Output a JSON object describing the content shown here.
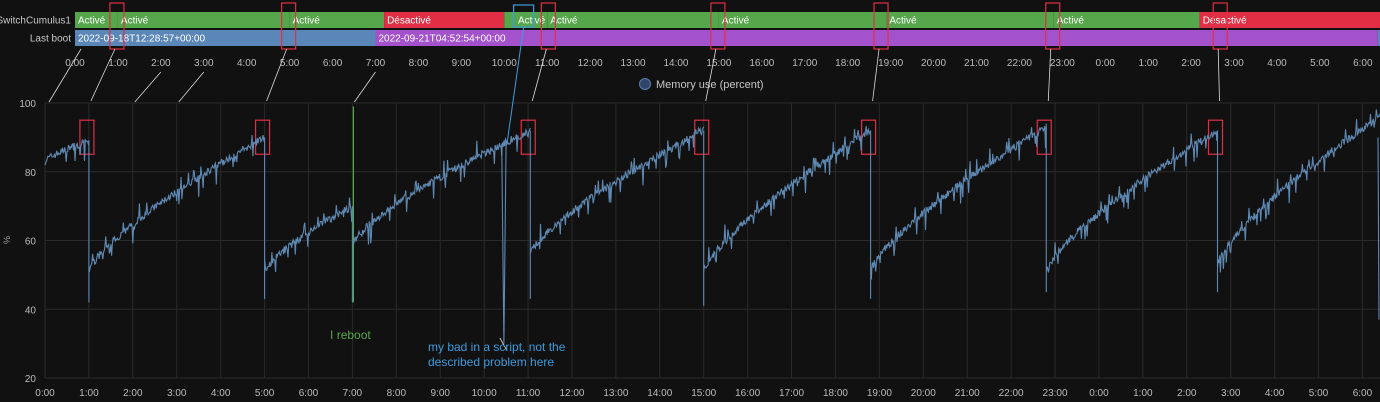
{
  "colors": {
    "background": "#111111",
    "active": "#56a64b",
    "inactive": "#e02f44",
    "boot_blue": "#5b87b8",
    "boot_purple": "#a352cc",
    "series": "#5f89b3",
    "grid": "#2a2a2a",
    "highlight": "#e02f44",
    "reboot_note": "#56a64b",
    "script_note": "#3e9bdc"
  },
  "timeline": {
    "rows": [
      {
        "label": "SwitchCumulus1",
        "segments": [
          {
            "label": "Activé",
            "state": "active",
            "start": 0.0,
            "end": 1.0
          },
          {
            "label": "Activé",
            "state": "active",
            "start": 1.0,
            "end": 5.0
          },
          {
            "label": "Activé",
            "state": "active",
            "start": 5.0,
            "end": 7.2
          },
          {
            "label": "Désactivé",
            "state": "inactive",
            "start": 7.2,
            "end": 10.0
          },
          {
            "label": "",
            "state": "active",
            "start": 10.0,
            "end": 10.25
          },
          {
            "label": "Activé",
            "state": "active",
            "start": 10.25,
            "end": 11.0
          },
          {
            "label": "Activé",
            "state": "active",
            "start": 11.0,
            "end": 15.0
          },
          {
            "label": "Activé",
            "state": "active",
            "start": 15.0,
            "end": 18.9
          },
          {
            "label": "Activé",
            "state": "active",
            "start": 18.9,
            "end": 22.8
          },
          {
            "label": "Activé",
            "state": "active",
            "start": 22.8,
            "end": 26.2
          },
          {
            "label": "Désactivé",
            "state": "inactive",
            "start": 26.2,
            "end": 30.4
          }
        ]
      },
      {
        "label": "Last boot",
        "segments": [
          {
            "label": "2022-09-18T12:28:57+00:00",
            "state": "boot_blue",
            "start": 0.0,
            "end": 7.0
          },
          {
            "label": "2022-09-21T04:52:54+00:00",
            "state": "boot_purple",
            "start": 7.0,
            "end": 30.35
          },
          {
            "label": "",
            "state": "boot_blue",
            "start": 30.35,
            "end": 30.4
          }
        ]
      }
    ],
    "tick_labels": [
      "0:00",
      "1:00",
      "2:00",
      "3:00",
      "4:00",
      "5:00",
      "6:00",
      "7:00",
      "8:00",
      "9:00",
      "10:00",
      "11:00",
      "12:00",
      "13:00",
      "14:00",
      "15:00",
      "16:00",
      "17:00",
      "18:00",
      "19:00",
      "20:00",
      "21:00",
      "22:00",
      "23:00",
      "0:00",
      "1:00",
      "2:00",
      "3:00",
      "4:00",
      "5:00",
      "6:00"
    ]
  },
  "chart_data": {
    "type": "line",
    "legend": [
      "Memory use (percent)"
    ],
    "legend_position": "top-center",
    "ylabel": "%",
    "ylim": [
      20,
      100
    ],
    "yticks": [
      20,
      40,
      60,
      80,
      100
    ],
    "xlim": [
      0,
      30.4
    ],
    "x_unit": "hours from 0:00 (wrapping past midnight)",
    "xtick_labels": [
      "0:00",
      "1:00",
      "2:00",
      "3:00",
      "4:00",
      "5:00",
      "6:00",
      "7:00",
      "8:00",
      "9:00",
      "10:00",
      "11:00",
      "12:00",
      "13:00",
      "14:00",
      "15:00",
      "16:00",
      "17:00",
      "18:00",
      "19:00",
      "20:00",
      "21:00",
      "22:00",
      "23:00",
      "0:00",
      "1:00",
      "2:00",
      "3:00",
      "4:00",
      "5:00",
      "6:00"
    ],
    "grid": true,
    "series": [
      {
        "name": "Memory use (percent)",
        "cycles": [
          {
            "start": 0.0,
            "end": 1.0,
            "y0": 83,
            "y1": 89
          },
          {
            "start": 1.0,
            "end": 5.0,
            "y0": 51,
            "y1": 90
          },
          {
            "start": 5.0,
            "end": 7.0,
            "y0": 51,
            "y1": 70
          },
          {
            "start": 7.0,
            "end": 11.05,
            "y0": 59,
            "y1": 92
          },
          {
            "start": 11.05,
            "end": 15.0,
            "y0": 56,
            "y1": 92
          },
          {
            "start": 15.0,
            "end": 18.8,
            "y0": 51,
            "y1": 92
          },
          {
            "start": 18.8,
            "end": 22.8,
            "y0": 51,
            "y1": 93
          },
          {
            "start": 22.8,
            "end": 26.7,
            "y0": 51,
            "y1": 92
          },
          {
            "start": 26.7,
            "end": 30.4,
            "y0": 53,
            "y1": 96
          }
        ],
        "dips": [
          {
            "x": 1.0,
            "y": 42
          },
          {
            "x": 5.0,
            "y": 43
          },
          {
            "x": 7.0,
            "y": 42
          },
          {
            "x": 10.45,
            "y": 30
          },
          {
            "x": 11.05,
            "y": 43
          },
          {
            "x": 15.0,
            "y": 41
          },
          {
            "x": 18.8,
            "y": 43
          },
          {
            "x": 22.8,
            "y": 45
          },
          {
            "x": 26.7,
            "y": 45
          },
          {
            "x": 30.4,
            "y": 37
          }
        ]
      }
    ],
    "annotations": {
      "highlight_times": [
        1.0,
        5.0,
        11.05,
        15.0,
        18.8,
        22.8,
        26.7
      ],
      "reboot_note": {
        "text": "I reboot",
        "x": 7.0
      },
      "script_note": {
        "lines": [
          "my bad in a script, not the",
          "described problem here"
        ],
        "x": 10.45
      }
    }
  }
}
